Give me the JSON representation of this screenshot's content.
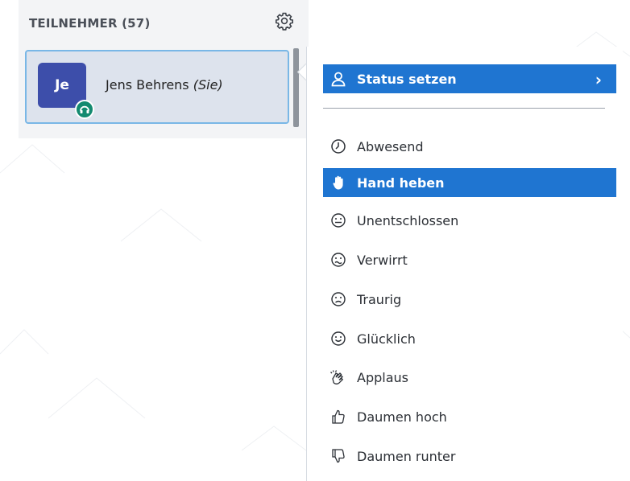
{
  "panel": {
    "title": "TEILNEHMER (57)",
    "user": {
      "initials": "Je",
      "name": "Jens Behrens",
      "you_suffix": "(Sie)"
    }
  },
  "menu": {
    "items": [
      {
        "label": "Status setzen",
        "icon": "person-icon",
        "active": true,
        "submenu": true
      },
      {
        "label": "Abwesend",
        "icon": "clock-icon",
        "active": false
      },
      {
        "label": "Hand heben",
        "icon": "hand-icon",
        "active": true
      },
      {
        "label": "Unentschlossen",
        "icon": "neutral-face-icon",
        "active": false
      },
      {
        "label": "Verwirrt",
        "icon": "confused-face-icon",
        "active": false
      },
      {
        "label": "Traurig",
        "icon": "sad-face-icon",
        "active": false
      },
      {
        "label": "Glücklich",
        "icon": "happy-face-icon",
        "active": false
      },
      {
        "label": "Applaus",
        "icon": "clapping-hands-icon",
        "active": false
      },
      {
        "label": "Daumen hoch",
        "icon": "thumbs-up-icon",
        "active": false
      },
      {
        "label": "Daumen runter",
        "icon": "thumbs-down-icon",
        "active": false
      }
    ]
  },
  "colors": {
    "accent": "#1f75d1",
    "avatar": "#3d4eaa",
    "mic_badge": "#138a70",
    "card_bg": "#dde3ed",
    "card_border": "#79b7e6"
  }
}
